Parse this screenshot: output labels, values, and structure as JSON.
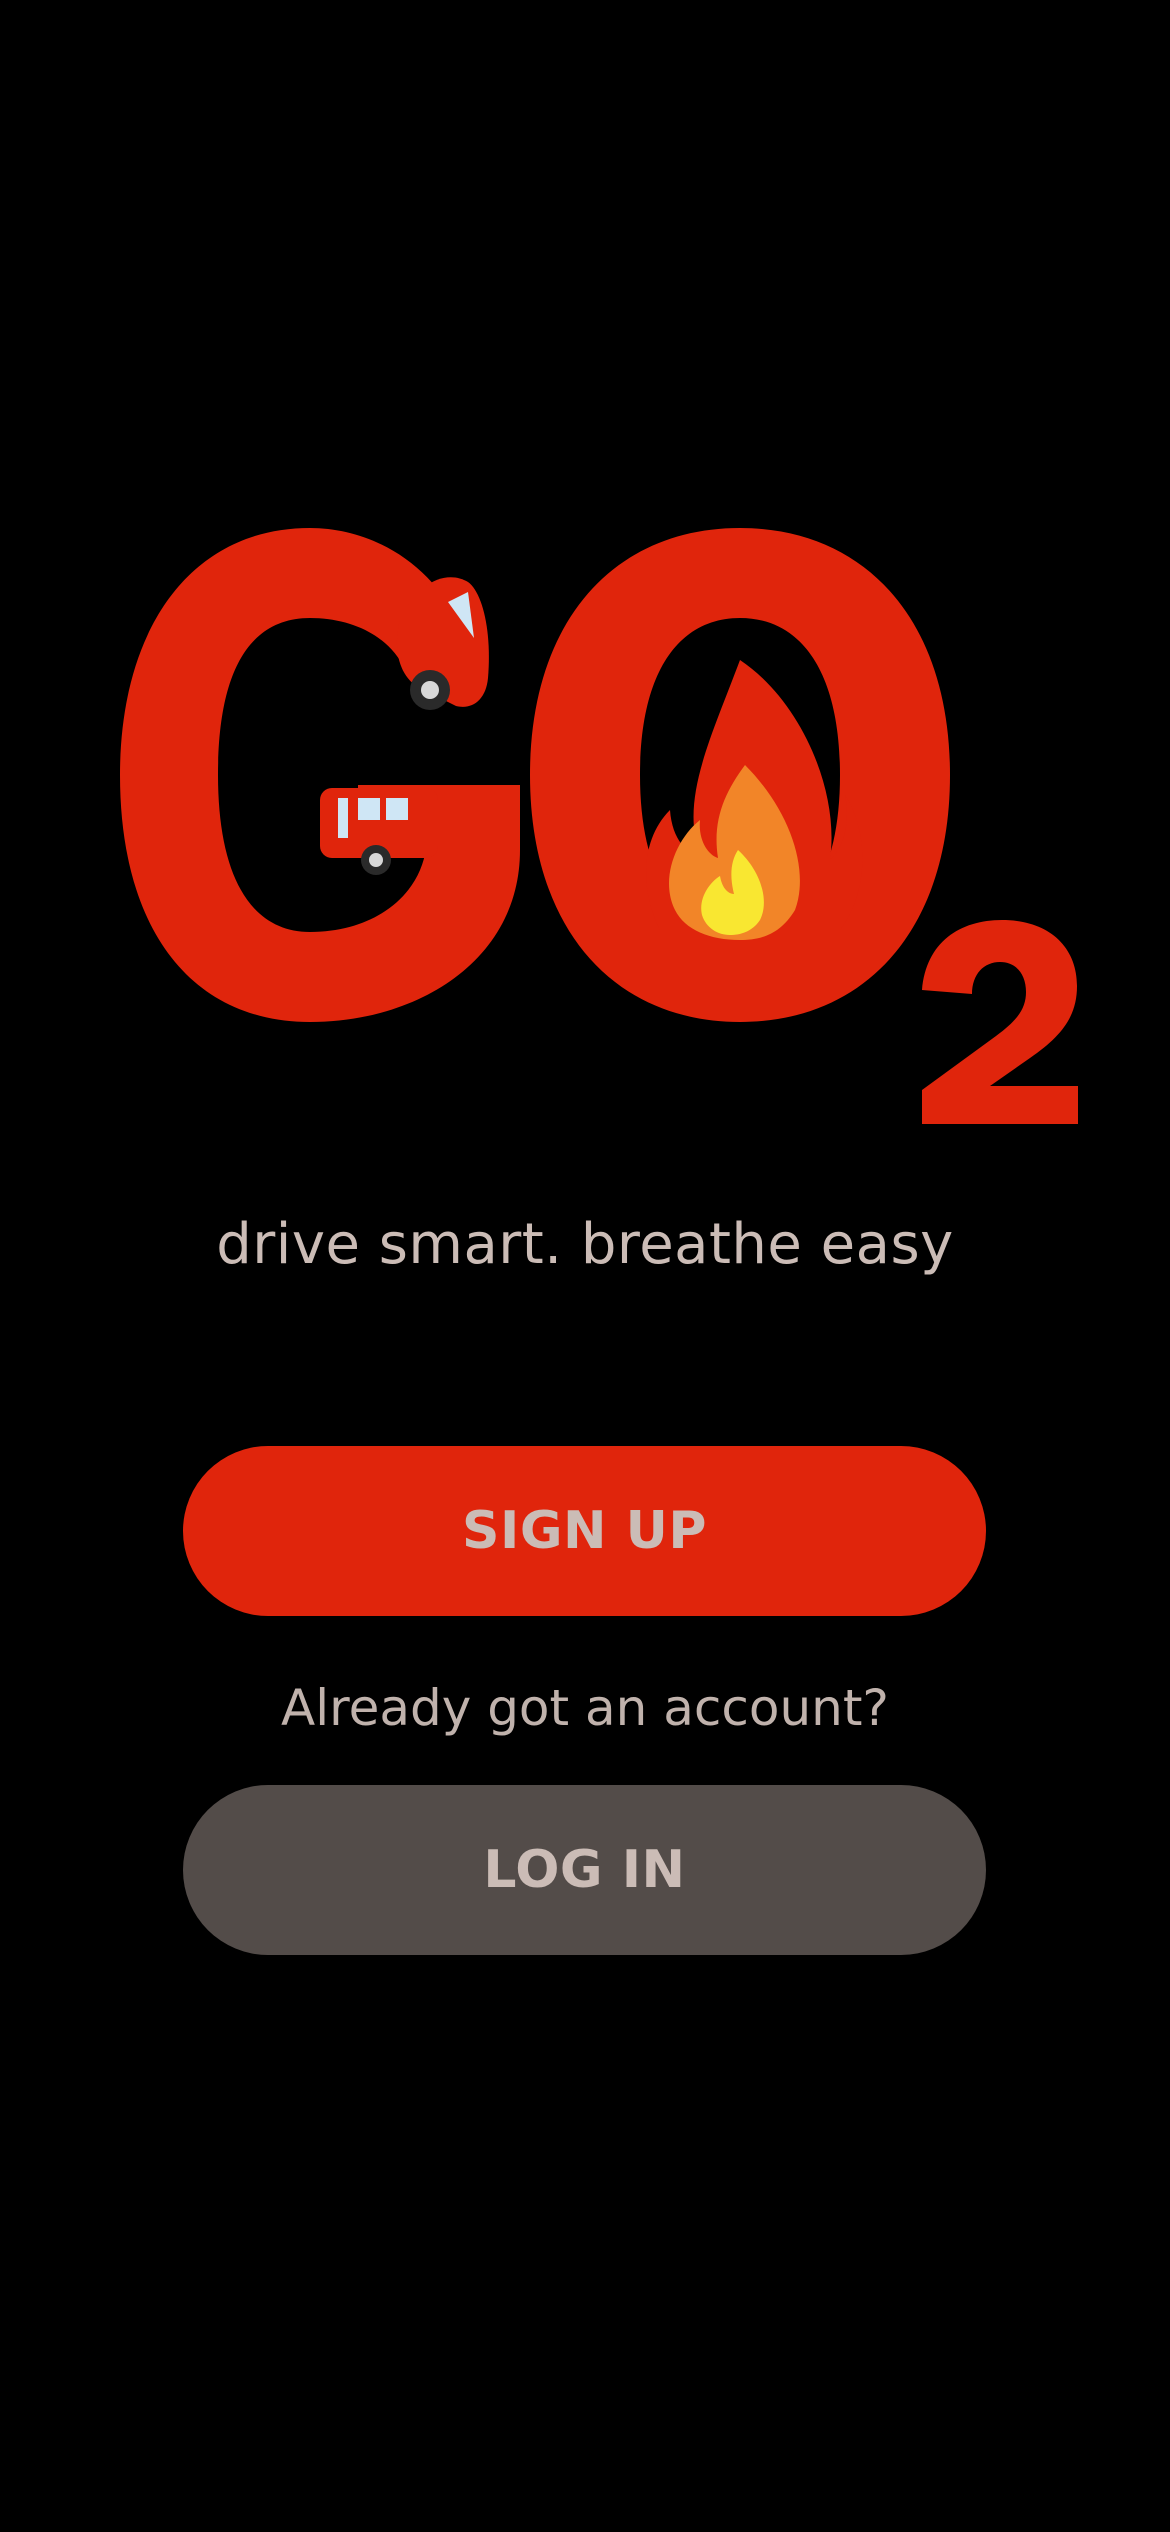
{
  "logo": {
    "wordmark": "GO",
    "subscript": "2",
    "brand_color": "#e0250c",
    "icons": [
      "car-icon",
      "bus-icon",
      "fire-icon"
    ]
  },
  "tagline": "drive smart. breathe easy",
  "signup": {
    "label": "SIGN UP",
    "color": "#e0250c"
  },
  "account_prompt": "Already got an account?",
  "login": {
    "label": "LOG IN",
    "color": "#534c49"
  },
  "text_color": "#cbbcb6",
  "background": "#000000"
}
